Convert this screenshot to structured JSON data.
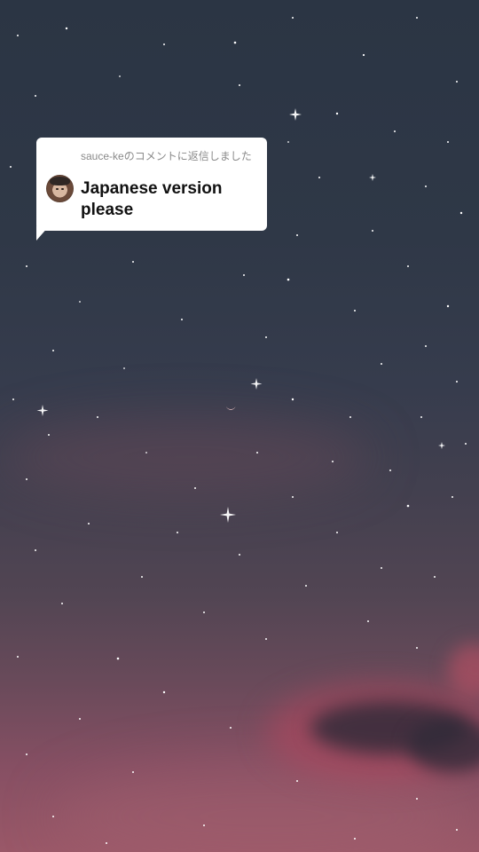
{
  "reply_sticker": {
    "header": "sauce-keのコメントに返信しました",
    "comment": "Japanese version please",
    "avatar_icon": "user-avatar"
  },
  "background": {
    "type": "night-sky",
    "colors": {
      "top": "#2b3544",
      "bottom": "#9a5868",
      "cloud_pink": "#b2465c",
      "moon": "#f2c9c9"
    }
  }
}
